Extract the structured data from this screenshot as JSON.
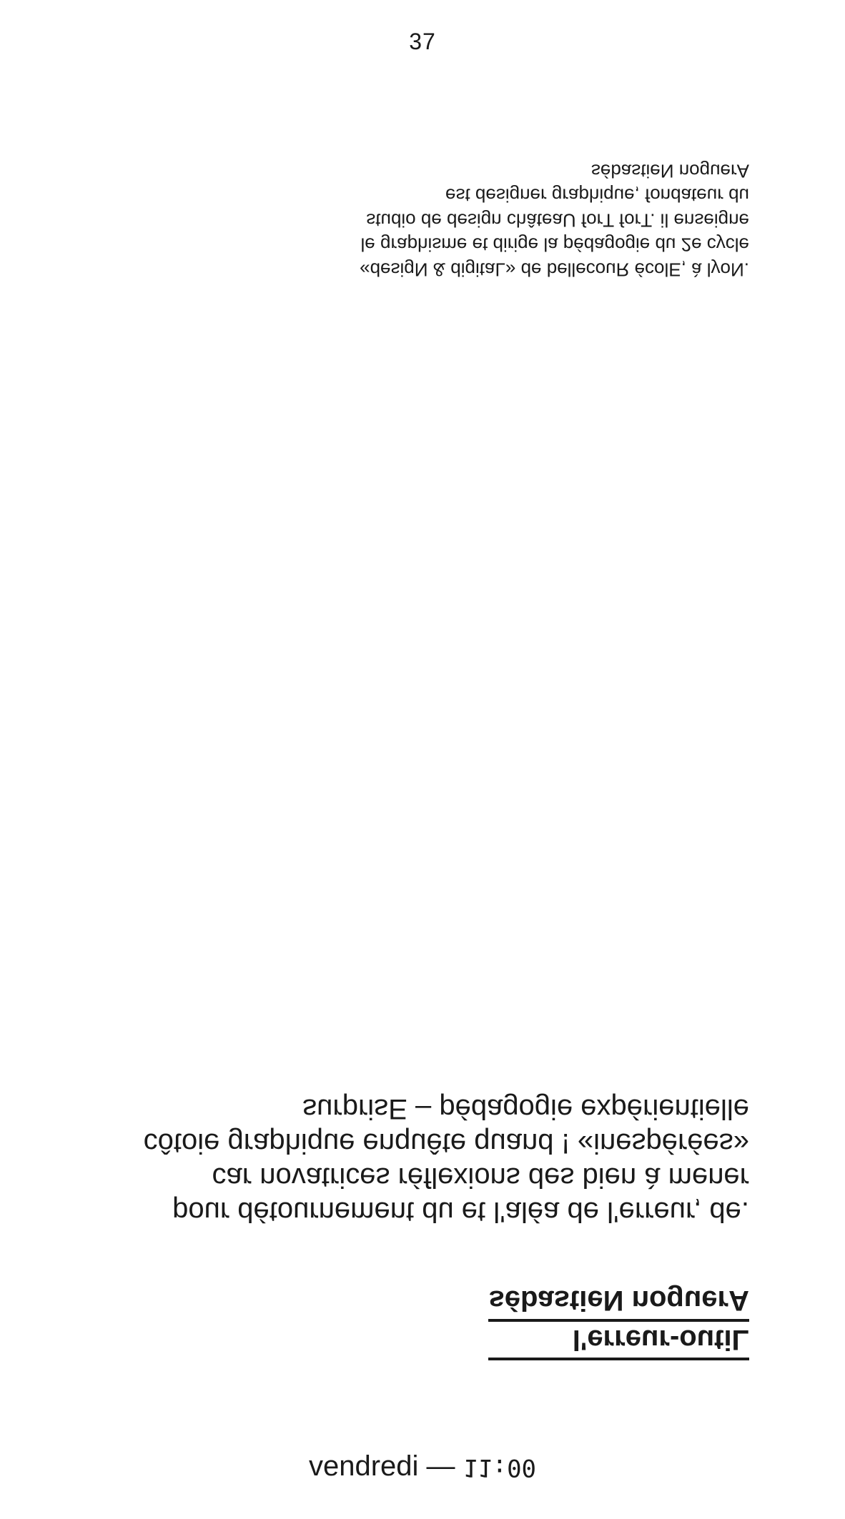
{
  "page": {
    "number": "37"
  },
  "bio": {
    "lines": [
      "sébastieN noguerA",
      "est designer graphique, fondateur du",
      "studio de design châteaU forT forT. il enseigne",
      "le graphisme et dirige la pédagogie du 2e cycle",
      "«desigN & digitaL» de bellecouR écolE, à lyoN."
    ]
  },
  "abstract": {
    "lines": [
      "surprisE – pédagogie expérientielle",
      "côtoie graphique enquête quand ! «inespérées»",
      "car novatrices réflexions des bien à mener",
      "pour détournement du et l'aléa de l'erreur, de."
    ]
  },
  "talk": {
    "author": "sébastieN noguerA",
    "title": "l'erreur-outiL"
  },
  "schedule": {
    "day": "vendredi —",
    "time": "11:00"
  }
}
